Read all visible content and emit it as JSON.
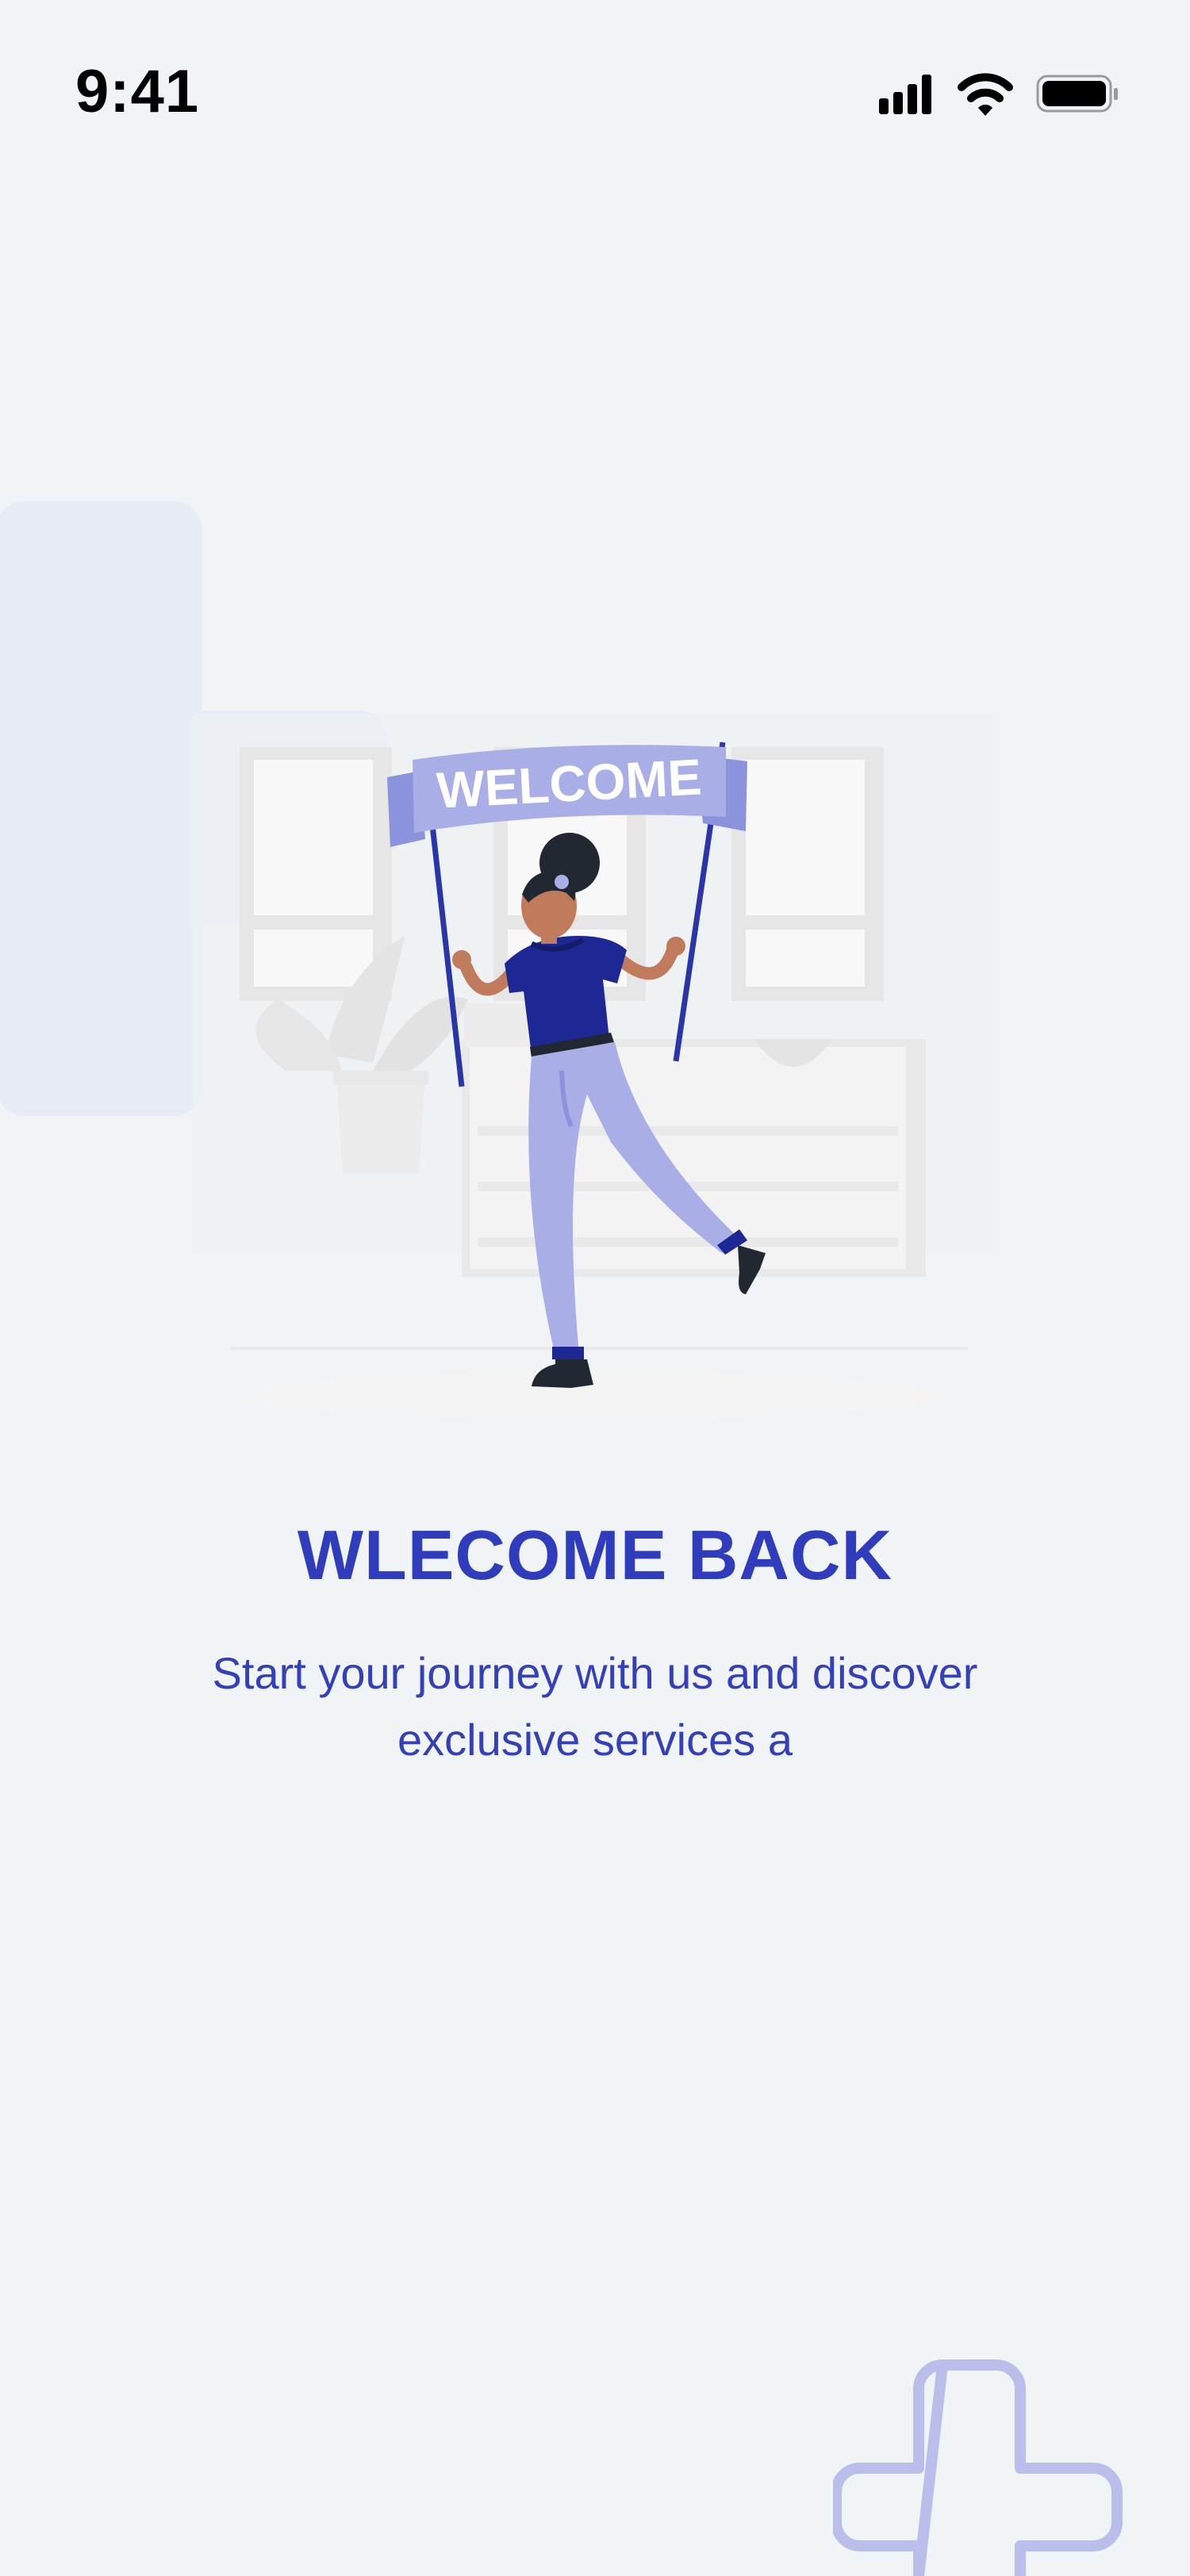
{
  "status_bar": {
    "time": "9:41",
    "icons": [
      "signal-icon",
      "wifi-icon",
      "battery-icon"
    ]
  },
  "illustration": {
    "banner_text": "WELCOME"
  },
  "onboarding": {
    "title": "WLECOME BACK",
    "subtitle": "Start your journey with us and discover exclusive services a"
  },
  "colors": {
    "background": "#f1f4f7",
    "primary": "#2f3dbc",
    "banner": "#a9afe6",
    "decor_outline": "#b9bfea",
    "decor_fill": "#e7ebf5"
  }
}
